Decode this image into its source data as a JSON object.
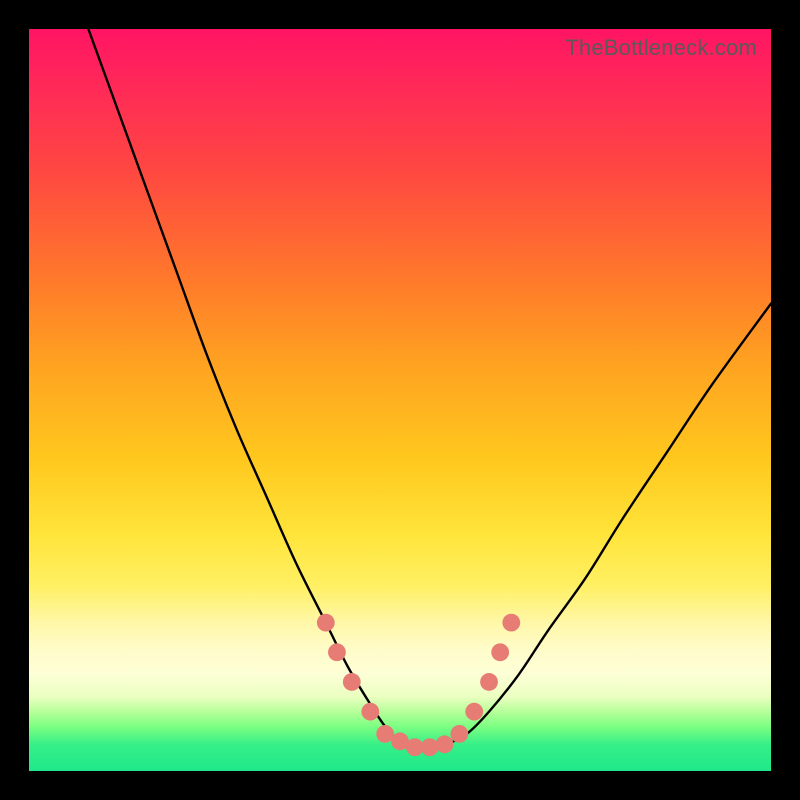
{
  "watermark": "TheBottleneck.com",
  "chart_data": {
    "type": "line",
    "title": "",
    "xlabel": "",
    "ylabel": "",
    "xlim": [
      0,
      100
    ],
    "ylim": [
      0,
      100
    ],
    "grid": false,
    "legend": false,
    "background_gradient_stops": [
      {
        "pos": 0,
        "color": "#ff1464"
      },
      {
        "pos": 8,
        "color": "#ff2a57"
      },
      {
        "pos": 20,
        "color": "#ff4a40"
      },
      {
        "pos": 34,
        "color": "#ff7a2a"
      },
      {
        "pos": 46,
        "color": "#ffa520"
      },
      {
        "pos": 58,
        "color": "#ffc81e"
      },
      {
        "pos": 68,
        "color": "#ffe43a"
      },
      {
        "pos": 75,
        "color": "#fff063"
      },
      {
        "pos": 80,
        "color": "#fff7a8"
      },
      {
        "pos": 84,
        "color": "#fffccc"
      },
      {
        "pos": 87,
        "color": "#fdffd6"
      },
      {
        "pos": 90,
        "color": "#eaffc0"
      },
      {
        "pos": 92,
        "color": "#b6ff9a"
      },
      {
        "pos": 94,
        "color": "#7cff82"
      },
      {
        "pos": 96.5,
        "color": "#35ef87"
      },
      {
        "pos": 100,
        "color": "#20e88a"
      }
    ],
    "series": [
      {
        "name": "bottleneck-curve",
        "color": "#000000",
        "x": [
          8,
          12,
          16,
          20,
          24,
          28,
          32,
          36,
          40,
          43,
          46,
          48,
          50,
          52,
          54,
          56,
          59,
          62,
          66,
          70,
          75,
          80,
          86,
          92,
          100
        ],
        "y": [
          100,
          89,
          78,
          67,
          56,
          46,
          37,
          28,
          20,
          14,
          9,
          6,
          4,
          3,
          3,
          3.5,
          5,
          8,
          13,
          19,
          26,
          34,
          43,
          52,
          63
        ]
      }
    ],
    "markers": {
      "name": "highlight-points",
      "color": "#e77c74",
      "radius": 1.2,
      "points": [
        {
          "x": 40,
          "y": 20
        },
        {
          "x": 41.5,
          "y": 16
        },
        {
          "x": 43.5,
          "y": 12
        },
        {
          "x": 46,
          "y": 8
        },
        {
          "x": 48,
          "y": 5
        },
        {
          "x": 50,
          "y": 4
        },
        {
          "x": 52,
          "y": 3.2
        },
        {
          "x": 54,
          "y": 3.2
        },
        {
          "x": 56,
          "y": 3.6
        },
        {
          "x": 58,
          "y": 5
        },
        {
          "x": 60,
          "y": 8
        },
        {
          "x": 62,
          "y": 12
        },
        {
          "x": 63.5,
          "y": 16
        },
        {
          "x": 65,
          "y": 20
        }
      ]
    }
  }
}
